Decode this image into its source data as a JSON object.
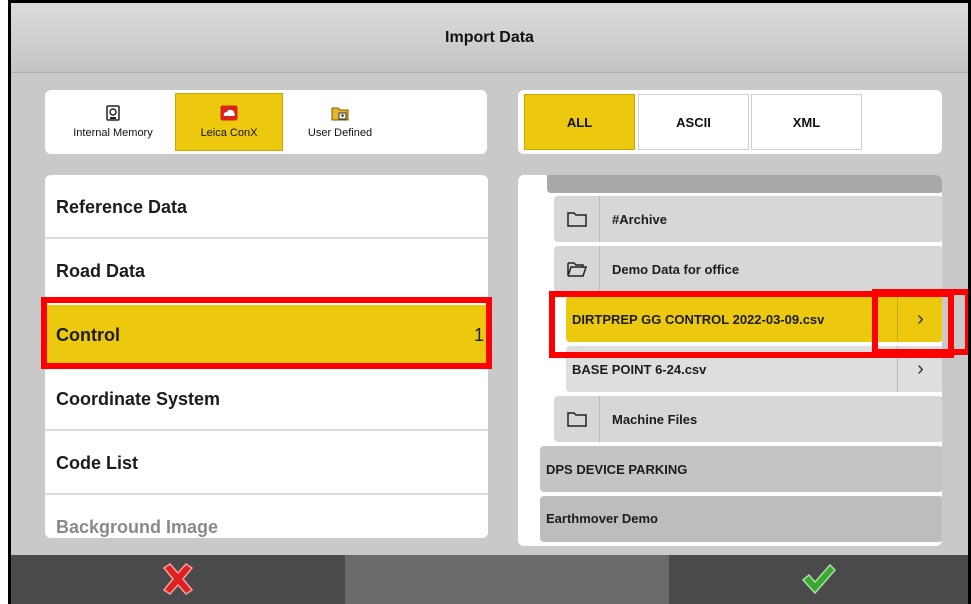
{
  "title": "Import Data",
  "sources": [
    {
      "label": "Internal Memory",
      "icon": "memory-card-icon",
      "active": false
    },
    {
      "label": "Leica ConX",
      "icon": "cloud-icon",
      "active": true
    },
    {
      "label": "User Defined",
      "icon": "folder-user-icon",
      "active": false
    }
  ],
  "formats": [
    {
      "label": "ALL",
      "active": true
    },
    {
      "label": "ASCII",
      "active": false
    },
    {
      "label": "XML",
      "active": false
    }
  ],
  "categories": [
    {
      "label": "Reference Data",
      "count": ""
    },
    {
      "label": "Road Data",
      "count": ""
    },
    {
      "label": "Control",
      "count": "1",
      "active": true
    },
    {
      "label": "Coordinate System",
      "count": ""
    },
    {
      "label": "Code List",
      "count": ""
    },
    {
      "label": "Background Image",
      "count": ""
    }
  ],
  "files": {
    "archive": "#Archive",
    "demo_folder": "Demo Data for office",
    "selected_file": "DIRTPREP GG CONTROL 2022-03-09.csv",
    "base_file": "BASE POINT 6-24.csv",
    "machine_folder": "Machine Files",
    "dps_device": "DPS DEVICE PARKING",
    "earthmover": "Earthmover Demo",
    "chevron": "›"
  },
  "colors": {
    "accent": "#ecc80e",
    "highlight": "#ff0000",
    "cancel": "#e02020",
    "confirm": "#3aa832"
  }
}
